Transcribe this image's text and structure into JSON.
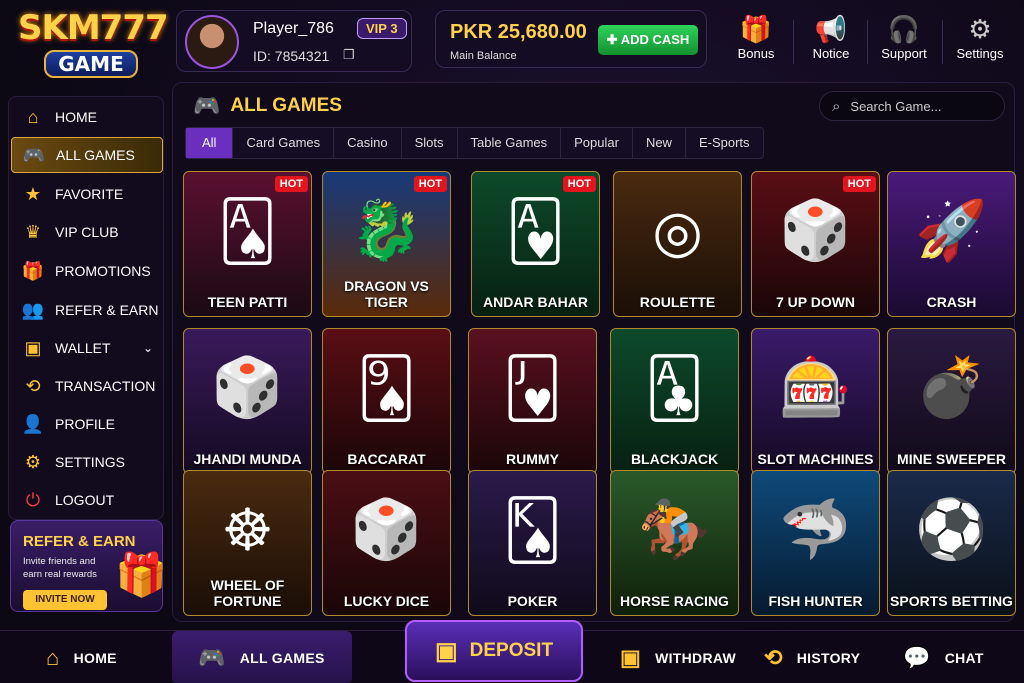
{
  "logo": {
    "line1": "SKM777",
    "line2": "GAME"
  },
  "player": {
    "name": "Player_786",
    "id": "ID: 7854321",
    "vip": "VIP 3"
  },
  "balance": {
    "amount": "PKR 25,680.00",
    "label": "Main Balance",
    "add_cash": "ADD CASH"
  },
  "top_actions": [
    {
      "label": "Bonus",
      "icon": "gift-icon"
    },
    {
      "label": "Notice",
      "icon": "megaphone-icon"
    },
    {
      "label": "Support",
      "icon": "headset-icon"
    },
    {
      "label": "Settings",
      "icon": "gear-icon"
    }
  ],
  "sidebar": {
    "items": [
      {
        "label": "HOME",
        "icon": "home-icon"
      },
      {
        "label": "ALL GAMES",
        "icon": "gamepad-icon",
        "active": true
      },
      {
        "label": "FAVORITE",
        "icon": "star-icon"
      },
      {
        "label": "VIP CLUB",
        "icon": "crown-icon"
      },
      {
        "label": "PROMOTIONS",
        "icon": "gift-icon"
      },
      {
        "label": "REFER & EARN",
        "icon": "users-icon"
      },
      {
        "label": "WALLET",
        "icon": "wallet-icon"
      },
      {
        "label": "TRANSACTION",
        "icon": "history-icon"
      },
      {
        "label": "PROFILE",
        "icon": "user-icon"
      },
      {
        "label": "SETTINGS",
        "icon": "gear-icon"
      },
      {
        "label": "LOGOUT",
        "icon": "power-icon"
      }
    ],
    "promo": {
      "title": "REFER & EARN",
      "subtitle": "Invite friends and earn real rewards",
      "button": "INVITE NOW"
    }
  },
  "main": {
    "title": "ALL GAMES",
    "search_placeholder": "Search Game...",
    "tabs": [
      "All",
      "Card Games",
      "Casino",
      "Slots",
      "Table Games",
      "Popular",
      "New",
      "E-Sports"
    ],
    "active_tab": "All",
    "hot_label": "HOT",
    "games": [
      {
        "name": "TEEN PATTI",
        "hot": true
      },
      {
        "name": "DRAGON VS TIGER",
        "hot": true
      },
      {
        "name": "ANDAR BAHAR",
        "hot": true
      },
      {
        "name": "ROULETTE",
        "hot": false
      },
      {
        "name": "7 UP DOWN",
        "hot": true
      },
      {
        "name": "CRASH",
        "hot": false
      },
      {
        "name": "JHANDI MUNDA",
        "hot": false
      },
      {
        "name": "BACCARAT",
        "hot": false
      },
      {
        "name": "RUMMY",
        "hot": false
      },
      {
        "name": "BLACKJACK",
        "hot": false
      },
      {
        "name": "SLOT MACHINES",
        "hot": false
      },
      {
        "name": "MINE SWEEPER",
        "hot": false
      },
      {
        "name": "WHEEL OF FORTUNE",
        "hot": false
      },
      {
        "name": "LUCKY DICE",
        "hot": false
      },
      {
        "name": "POKER",
        "hot": false
      },
      {
        "name": "HORSE RACING",
        "hot": false
      },
      {
        "name": "FISH HUNTER",
        "hot": false
      },
      {
        "name": "SPORTS BETTING",
        "hot": false
      }
    ]
  },
  "bottom_nav": {
    "home": "HOME",
    "all_games": "ALL GAMES",
    "deposit": "DEPOSIT",
    "withdraw": "WITHDRAW",
    "history": "HISTORY",
    "chat": "CHAT"
  },
  "colors": {
    "accent_gold": "#ffd24a",
    "accent_purple": "#6a2fbf",
    "hot_red": "#e0151e",
    "add_cash_green": "#1fb546"
  }
}
